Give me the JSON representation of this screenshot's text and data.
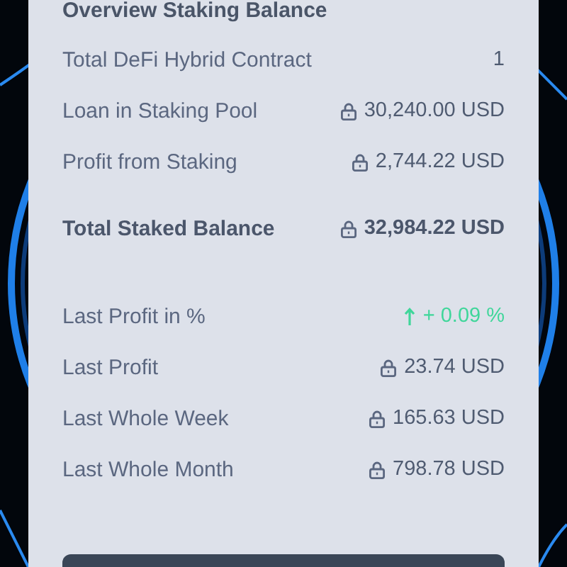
{
  "title": "Overview Staking Balance",
  "groups": [
    {
      "rows": [
        {
          "label": "Total DeFi Hybrid Contract",
          "value": "1",
          "kind": "plain",
          "emphasis": false
        },
        {
          "label": "Loan in Staking Pool",
          "value": "30,240.00 USD",
          "kind": "locked",
          "emphasis": false
        },
        {
          "label": "Profit from Staking",
          "value": "2,744.22 USD",
          "kind": "locked",
          "emphasis": false
        },
        {
          "label": "Total Staked Balance",
          "value": "32,984.22 USD",
          "kind": "locked",
          "emphasis": true
        }
      ]
    },
    {
      "rows": [
        {
          "label": "Last Profit in %",
          "value": "+ 0.09 %",
          "kind": "gain",
          "emphasis": false
        },
        {
          "label": "Last Profit",
          "value": "23.74 USD",
          "kind": "locked",
          "emphasis": false
        },
        {
          "label": "Last Whole Week",
          "value": "165.63 USD",
          "kind": "locked",
          "emphasis": false
        },
        {
          "label": "Last Whole Month",
          "value": "798.78 USD",
          "kind": "locked",
          "emphasis": false
        }
      ]
    }
  ]
}
